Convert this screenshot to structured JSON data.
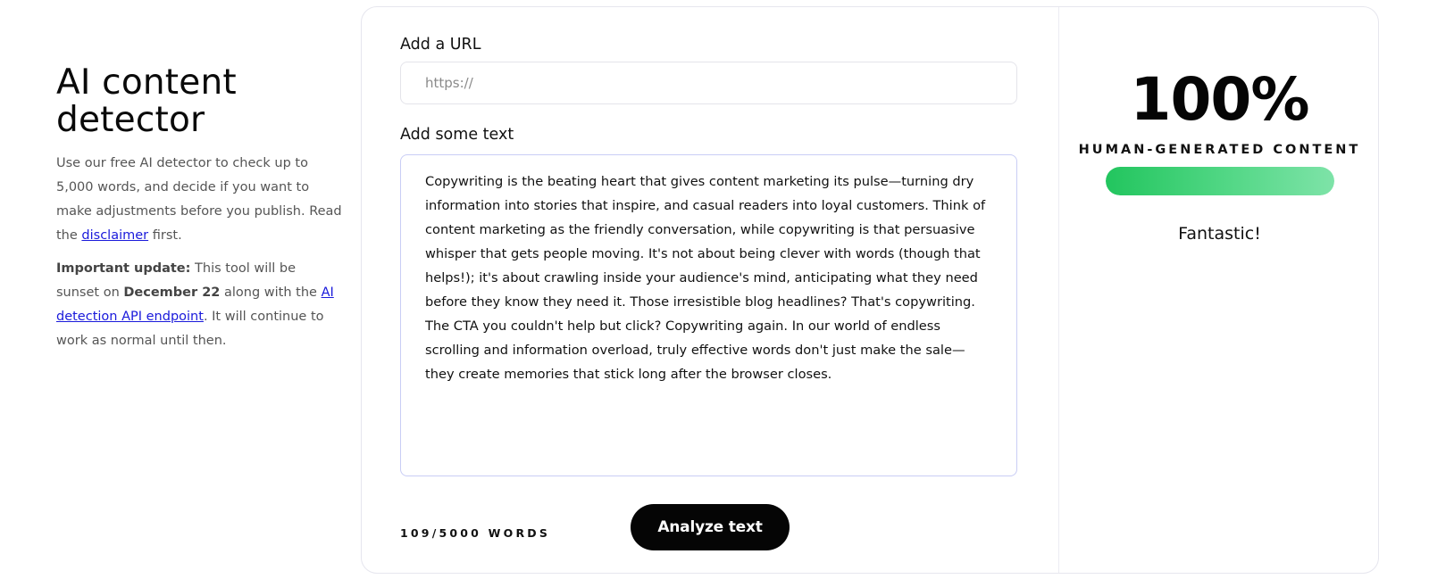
{
  "intro": {
    "title_line1": "AI content",
    "title_line2": "detector",
    "desc_before_link": "Use our free AI detector to check up to 5,000 words, and decide if you want to make adjustments before you publish. Read the ",
    "disclaimer_link": "disclaimer",
    "desc_after_link": " first.",
    "update_label": "Important update:",
    "update_text1": " This tool will be sunset on ",
    "update_date": "December 22",
    "update_text2": " along with the ",
    "api_link": "AI detection API endpoint",
    "update_text3": ". It will continue to work as normal until then."
  },
  "form": {
    "url_label": "Add a URL",
    "url_placeholder": "https://",
    "text_label": "Add some text",
    "text_value": "Copywriting is the beating heart that gives content marketing its pulse—turning dry information into stories that inspire, and casual readers into loyal customers. Think of content marketing as the friendly conversation, while copywriting is that persuasive whisper that gets people moving. It's not about being clever with words (though that helps!); it's about crawling inside your audience's mind, anticipating what they need before they know they need it. Those irresistible blog headlines? That's copywriting. The CTA you couldn't help but click? Copywriting again. In our world of endless scrolling and information overload, truly effective words don't just make the sale—they create memories that stick long after the browser closes.",
    "word_count": "109/5000",
    "word_count_suffix": "WORDS",
    "analyze_button": "Analyze text"
  },
  "result": {
    "percent": "100%",
    "label": "HUMAN-GENERATED CONTENT",
    "meter_fraction": 1.0,
    "verdict": "Fantastic!",
    "meter_color": "#22c55e"
  }
}
